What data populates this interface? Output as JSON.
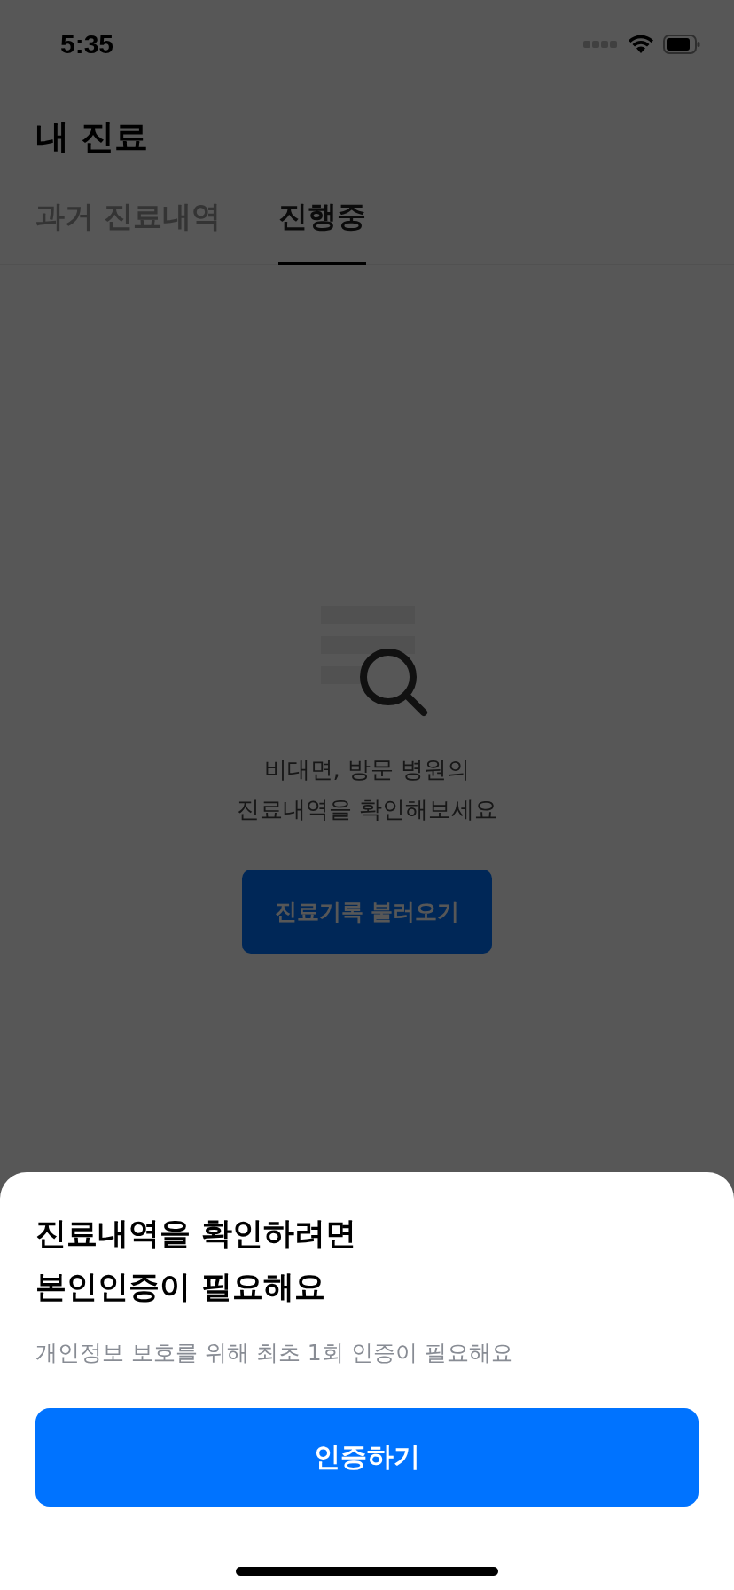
{
  "status_bar": {
    "time": "5:35"
  },
  "header": {
    "title": "내 진료"
  },
  "tabs": [
    {
      "label": "과거 진료내역",
      "selected": false
    },
    {
      "label": "진행중",
      "selected": true
    }
  ],
  "empty_state": {
    "message": "비대면, 방문 병원의\n진료내역을 확인해보세요",
    "button": "진료기록 불러오기"
  },
  "bottom_sheet": {
    "title": "진료내역을 확인하려면\n본인인증이 필요해요",
    "description": "개인정보 보호를 위해 최초 1회 인증이 필요해요",
    "button": "인증하기"
  }
}
